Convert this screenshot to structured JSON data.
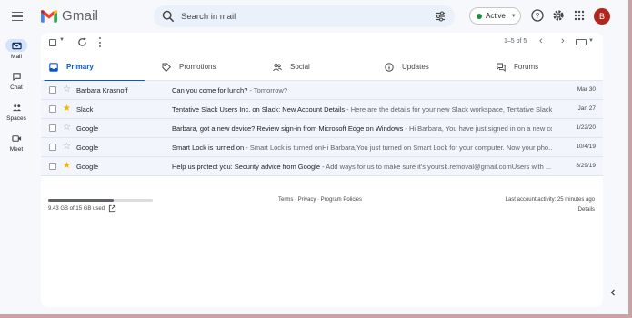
{
  "app": {
    "name": "Gmail"
  },
  "search": {
    "placeholder": "Search in mail"
  },
  "status": {
    "label": "Active",
    "color": "#1e8e3e"
  },
  "user": {
    "avatar_initial": "B",
    "avatar_color": "#b3261e"
  },
  "icons": {
    "menu": "hamburger-menu-icon",
    "search": "search-icon",
    "filter": "search-options-icon",
    "help": "help-icon",
    "settings": "gear-icon",
    "apps": "apps-grid-icon"
  },
  "rail": {
    "items": [
      {
        "label": "Mail",
        "icon": "mail-icon",
        "active": true
      },
      {
        "label": "Chat",
        "icon": "chat-icon",
        "active": false
      },
      {
        "label": "Spaces",
        "icon": "spaces-icon",
        "active": false
      },
      {
        "label": "Meet",
        "icon": "meet-icon",
        "active": false
      }
    ]
  },
  "toolbar": {
    "pagination": "1–5 of 5"
  },
  "tabs": [
    {
      "label": "Primary",
      "icon": "inbox-icon",
      "active": true
    },
    {
      "label": "Promotions",
      "icon": "tag-icon",
      "active": false
    },
    {
      "label": "Social",
      "icon": "people-icon",
      "active": false
    },
    {
      "label": "Updates",
      "icon": "info-icon",
      "active": false
    },
    {
      "label": "Forums",
      "icon": "forum-icon",
      "active": false
    }
  ],
  "emails": [
    {
      "sender": "Barbara Krasnoff",
      "starred": false,
      "subject": "Can you come for lunch?",
      "snippet": " - Tomorrow?",
      "date": "Mar 30"
    },
    {
      "sender": "Slack",
      "starred": true,
      "subject": "Tentative Slack Users Inc. on Slack: New Account Details",
      "snippet": " - Here are the details for your new Slack workspace, Tentative Slack ...",
      "date": "Jan 27"
    },
    {
      "sender": "Google",
      "starred": false,
      "subject": "Barbara, got a new device? Review sign-in from Microsoft Edge on Windows",
      "snippet": " - Hi Barbara, You have just signed in on a new co...",
      "date": "1/22/20"
    },
    {
      "sender": "Google",
      "starred": false,
      "subject": "Smart Lock is turned on",
      "snippet": " - Smart Lock is turned onHi Barbara,You just turned on Smart Lock for your computer. Now your pho...",
      "date": "10/4/19"
    },
    {
      "sender": "Google",
      "starred": true,
      "subject": "Help us protect you: Security advice from Google",
      "snippet": " - Add ways for us to make sure it's yoursk.removal@gmail.comUsers with ...",
      "date": "8/29/19"
    }
  ],
  "footer": {
    "storage_text": "9.43 GB of 15 GB used",
    "storage_used_fraction": 0.63,
    "links": "Terms · Privacy · Program Policies",
    "last_activity": "Last account activity: 25 minutes ago",
    "details": "Details"
  }
}
